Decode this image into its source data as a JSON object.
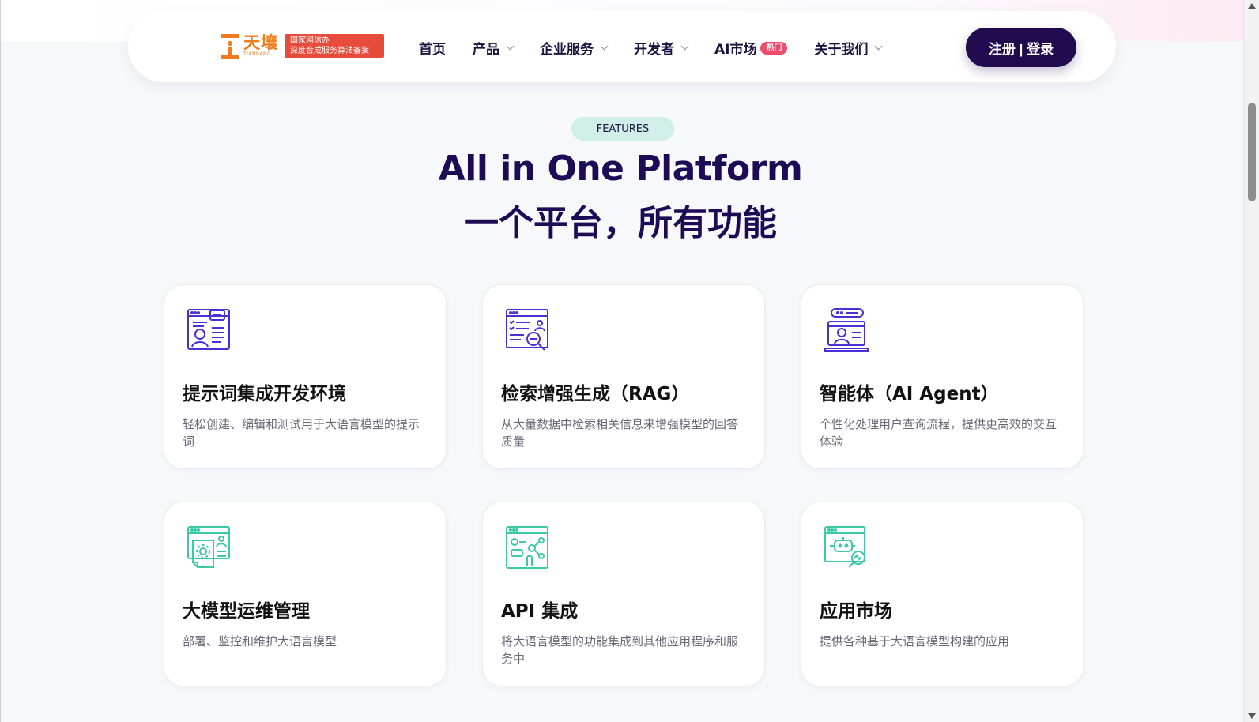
{
  "brand": {
    "name": "天壤",
    "sub": "TIANRANG",
    "registration_line1": "国家网信办",
    "registration_line2": "深度合成服务算法备案",
    "color": "#f07b1a",
    "badge_color": "#e74b3c"
  },
  "nav": {
    "items": [
      {
        "label": "首页",
        "has_dropdown": false
      },
      {
        "label": "产品",
        "has_dropdown": true
      },
      {
        "label": "企业服务",
        "has_dropdown": true
      },
      {
        "label": "开发者",
        "has_dropdown": true
      },
      {
        "label": "AI市场",
        "has_dropdown": false,
        "badge": "热门"
      },
      {
        "label": "关于我们",
        "has_dropdown": true
      }
    ],
    "login_label": "注册 | 登录",
    "login_color": "#220a4e"
  },
  "section": {
    "tag": "FEATURES",
    "title_en": "All in One Platform",
    "title_zh": "一个平台，所有功能",
    "title_color": "#1e0a55"
  },
  "cards": [
    {
      "title": "提示词集成开发环境",
      "desc": "轻松创建、编辑和测试用于大语言模型的提示词",
      "icon": "prompt-ide-icon",
      "icon_color": "#4b2fd6"
    },
    {
      "title": "检索增强生成（RAG）",
      "desc": "从大量数据中检索相关信息来增强模型的回答质量",
      "icon": "document-search-icon",
      "icon_color": "#4b2fd6"
    },
    {
      "title": "智能体（AI Agent）",
      "desc": "个性化处理用户查询流程，提供更高效的交互体验",
      "icon": "laptop-agent-icon",
      "icon_color": "#4b2fd6"
    },
    {
      "title": "大模型运维管理",
      "desc": "部署、监控和维护大语言模型",
      "icon": "settings-document-icon",
      "icon_color": "#3cc9a8"
    },
    {
      "title": "API 集成",
      "desc": "将大语言模型的功能集成到其他应用程序和服务中",
      "icon": "api-network-icon",
      "icon_color": "#3cc9a8"
    },
    {
      "title": "应用市场",
      "desc": "提供各种基于大语言模型构建的应用",
      "icon": "app-market-icon",
      "icon_color": "#3cc9a8"
    }
  ]
}
